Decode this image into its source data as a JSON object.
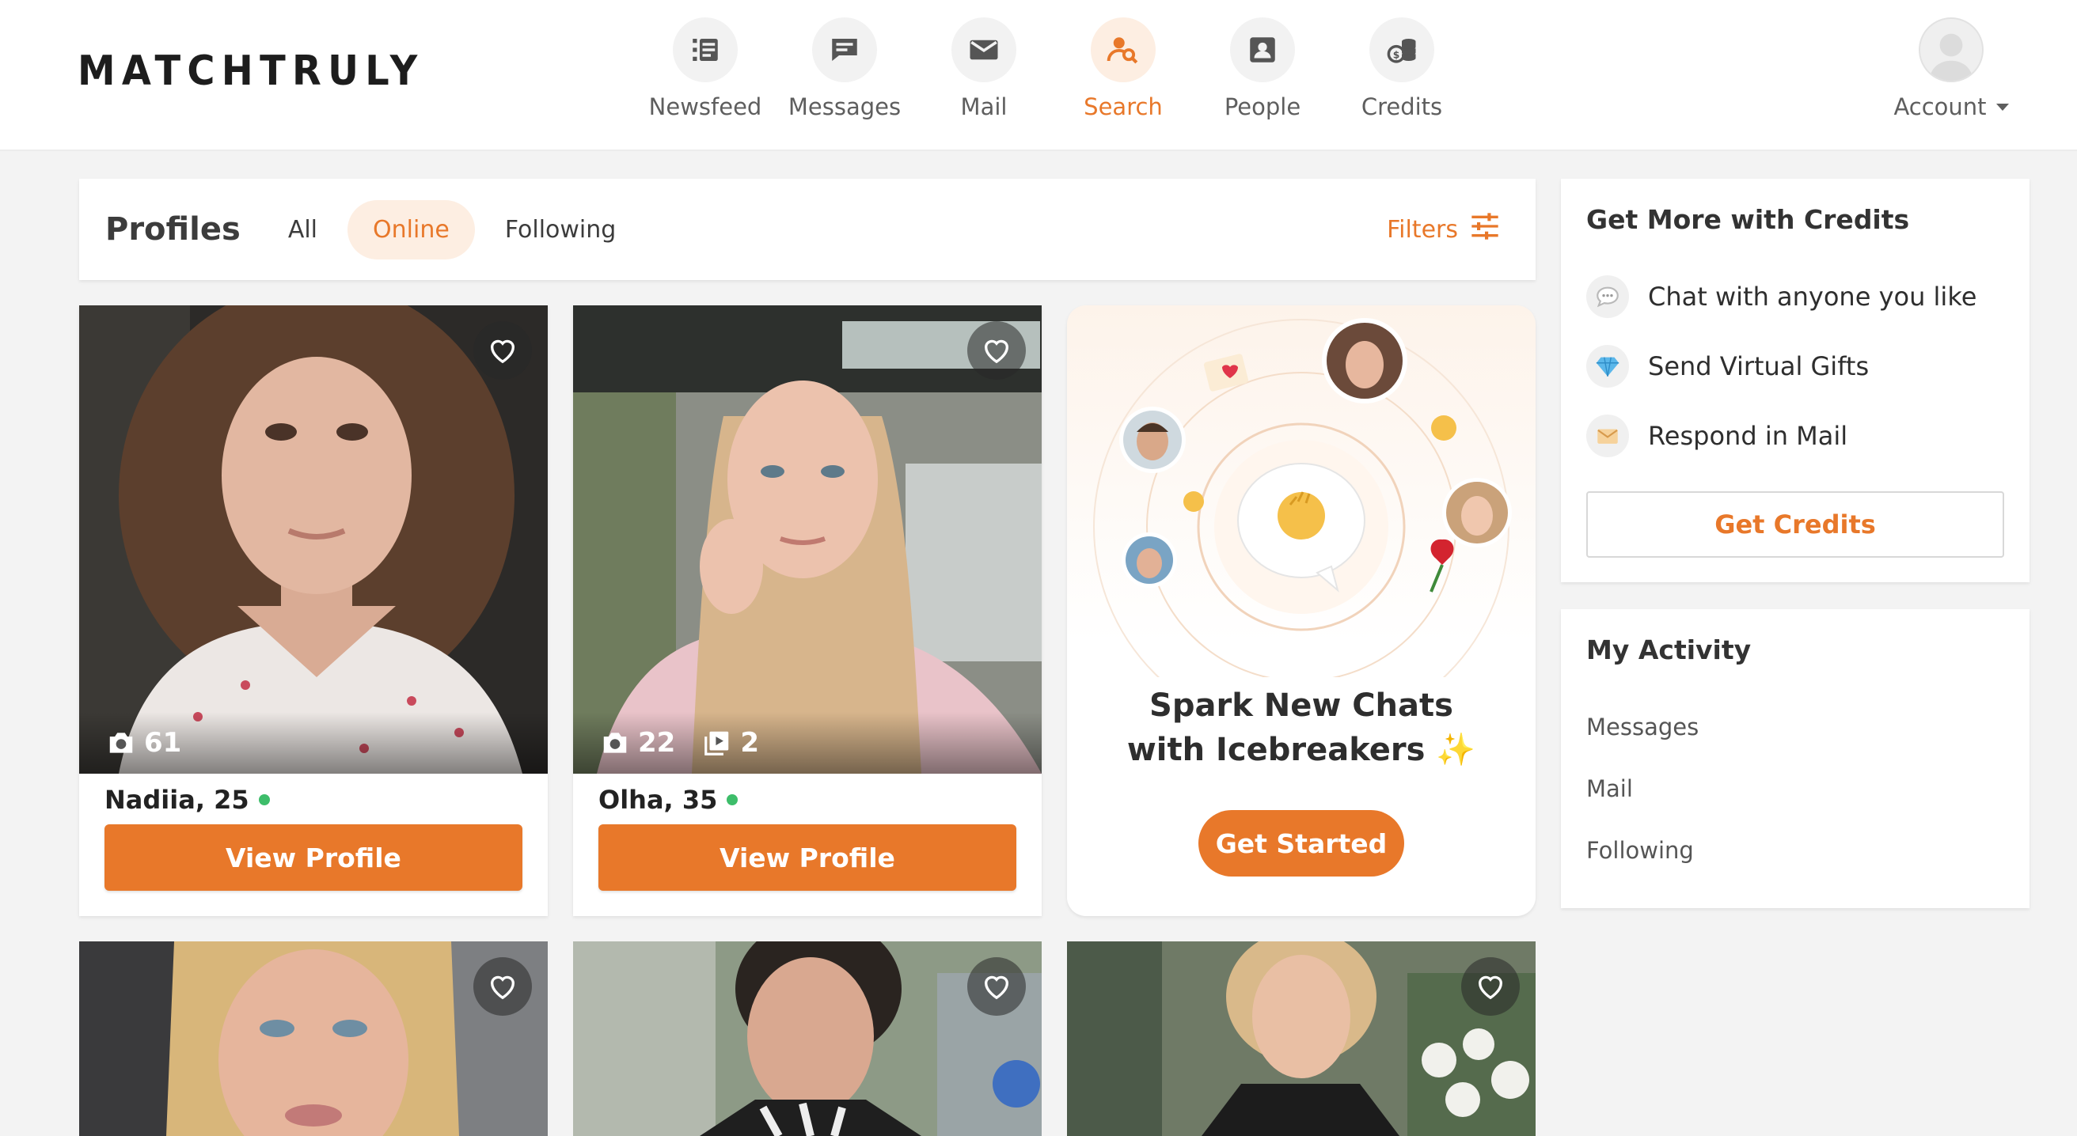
{
  "header": {
    "logo": "MATCHTRULY",
    "nav": [
      {
        "id": "newsfeed",
        "label": "Newsfeed",
        "icon": "newsfeed-icon"
      },
      {
        "id": "messages",
        "label": "Messages",
        "icon": "chat-bubble-icon"
      },
      {
        "id": "mail",
        "label": "Mail",
        "icon": "envelope-icon"
      },
      {
        "id": "search",
        "label": "Search",
        "icon": "person-search-icon",
        "active": true
      },
      {
        "id": "people",
        "label": "People",
        "icon": "contact-card-icon"
      },
      {
        "id": "credits",
        "label": "Credits",
        "icon": "coins-icon"
      }
    ],
    "account_label": "Account"
  },
  "profiles_bar": {
    "title": "Profiles",
    "tabs": [
      {
        "label": "All",
        "active": false
      },
      {
        "label": "Online",
        "active": true
      },
      {
        "label": "Following",
        "active": false
      }
    ],
    "filters_label": "Filters"
  },
  "profiles": [
    {
      "name": "Nadiia, 25",
      "online": true,
      "photos": "61",
      "view_label": "View Profile"
    },
    {
      "name": "Olha, 35",
      "online": true,
      "photos": "22",
      "videos": "2",
      "view_label": "View Profile"
    }
  ],
  "promo": {
    "title_line1": "Spark New Chats",
    "title_line2": "with Icebreakers",
    "sparkle": "✨",
    "button": "Get Started"
  },
  "credits_panel": {
    "title": "Get More with Credits",
    "perks": [
      {
        "label": "Chat with anyone you like",
        "icon": "chat-bubble-icon"
      },
      {
        "label": "Send Virtual Gifts",
        "icon": "diamond-icon"
      },
      {
        "label": "Respond in Mail",
        "icon": "envelope-icon"
      }
    ],
    "button": "Get Credits"
  },
  "activity_panel": {
    "title": "My Activity",
    "links": [
      "Messages",
      "Mail",
      "Following"
    ]
  },
  "colors": {
    "accent": "#e8782a",
    "accent_light": "#fdeee2",
    "online": "#3dbd6a"
  }
}
